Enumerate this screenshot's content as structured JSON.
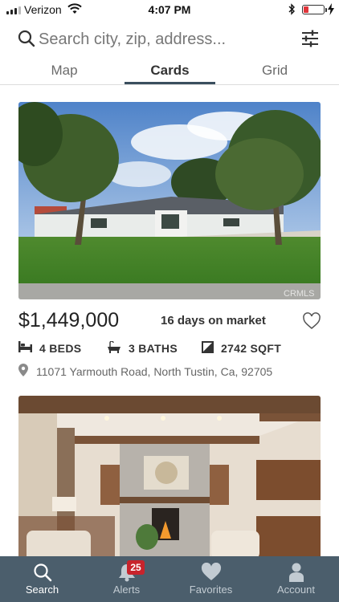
{
  "status_bar": {
    "carrier": "Verizon",
    "time": "4:07 PM",
    "battery_level": 0.25,
    "battery_color": "#e0353b"
  },
  "search": {
    "placeholder": "Search city, zip, address...",
    "value": "",
    "icon": "search-icon",
    "filter_icon": "sliders-icon"
  },
  "tabs": [
    {
      "label": "Map",
      "active": false
    },
    {
      "label": "Cards",
      "active": true
    },
    {
      "label": "Grid",
      "active": false
    }
  ],
  "listings": [
    {
      "price": "$1,449,000",
      "days_on_market": "16 days on market",
      "beds": "4 BEDS",
      "baths": "3 BATHS",
      "sqft": "2742 SQFT",
      "address": "11071 Yarmouth Road, North Tustin, Ca, 92705",
      "watermark": "CRMLS",
      "favorited": false
    },
    {
      "photo": "living-room-interior"
    }
  ],
  "bottom_nav": [
    {
      "label": "Search",
      "icon": "search-icon",
      "active": true
    },
    {
      "label": "Alerts",
      "icon": "bell-icon",
      "badge": "25",
      "active": false
    },
    {
      "label": "Favorites",
      "icon": "heart-icon",
      "active": false
    },
    {
      "label": "Account",
      "icon": "person-icon",
      "active": false
    }
  ],
  "colors": {
    "nav_background": "#4b5e6c",
    "tab_underline": "#3a4f5e",
    "badge": "#c8232c"
  }
}
